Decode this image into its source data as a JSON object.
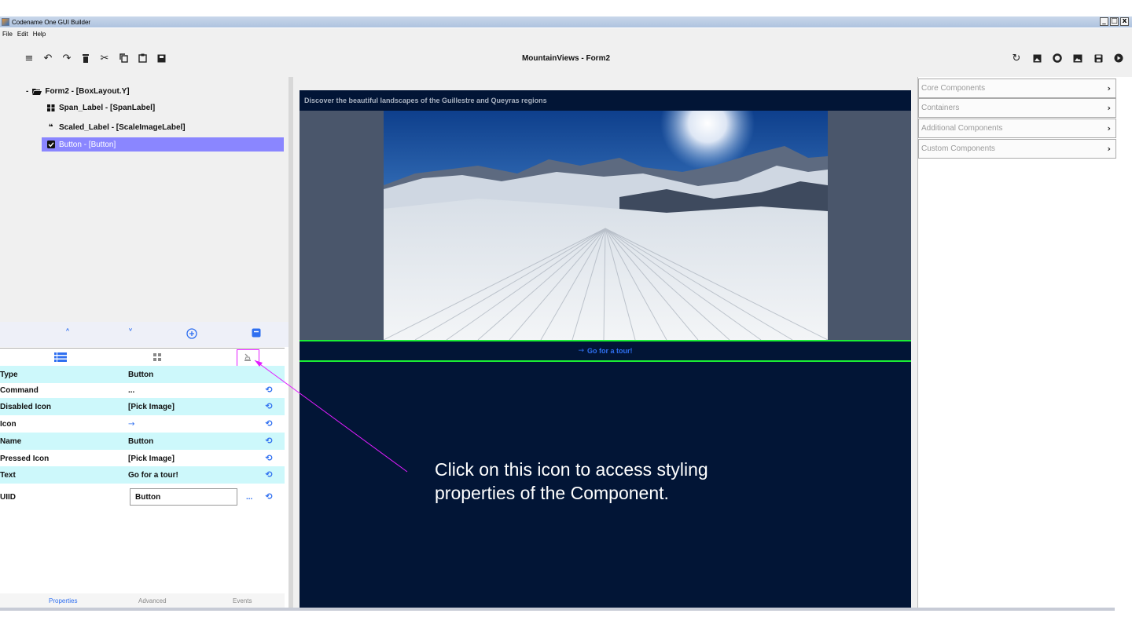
{
  "window": {
    "title": "Codename One GUI Builder",
    "controls": [
      "_",
      "□",
      "x"
    ]
  },
  "menu": {
    "items": [
      "File",
      "Edit",
      "Help"
    ]
  },
  "toolbar": {
    "form_title": "MountainViews - Form2",
    "left_icons": [
      "hamburger-icon",
      "undo-icon",
      "redo-icon",
      "delete-icon",
      "cut-icon",
      "copy-icon",
      "paste-icon",
      "save-icon"
    ],
    "right_icons": [
      "refresh-icon",
      "image-icon",
      "circle-icon",
      "image-alt-icon",
      "floppy-icon",
      "play-icon"
    ]
  },
  "tree": {
    "items": [
      {
        "label": "Form2 - [BoxLayout.Y]",
        "icon": "folder-open-icon",
        "toggle": "-"
      },
      {
        "label": "Span_Label - [SpanLabel]",
        "icon": "grid-icon"
      },
      {
        "label": "Scaled_Label - [ScaleImageLabel]",
        "icon": "quote-icon"
      },
      {
        "label": "Button - [Button]",
        "icon": "checkbox-icon",
        "selected": true
      }
    ]
  },
  "properties": {
    "rows": [
      {
        "key": "Type",
        "value": "Button"
      },
      {
        "key": "Command",
        "value": "..."
      },
      {
        "key": "Disabled Icon",
        "value": "[Pick Image]"
      },
      {
        "key": "Icon",
        "value": "→"
      },
      {
        "key": "Name",
        "value": "Button"
      },
      {
        "key": "Pressed Icon",
        "value": "[Pick Image]"
      },
      {
        "key": "Text",
        "value": "Go for a tour!"
      }
    ],
    "uiid": {
      "key": "UIID",
      "value": "Button",
      "more": "..."
    }
  },
  "bottom_tabs": [
    "Properties",
    "Advanced",
    "Events"
  ],
  "canvas": {
    "span_label": "Discover the beautiful landscapes of the Guillestre and Queyras regions",
    "button_text": "Go for a tour!",
    "button_icon": "→"
  },
  "annotation": {
    "text": "Click on this icon to access styling properties of the Component."
  },
  "palette": {
    "sections": [
      "Core Components",
      "Containers",
      "Additional Components",
      "Custom Components"
    ]
  },
  "colors": {
    "accent": "#2f6ff0",
    "selection": "#8a86ff",
    "canvas_bg": "#021536",
    "highlight": "#e21cff",
    "selection_outline": "#1aee35",
    "alt_row": "#cdf8fb"
  }
}
